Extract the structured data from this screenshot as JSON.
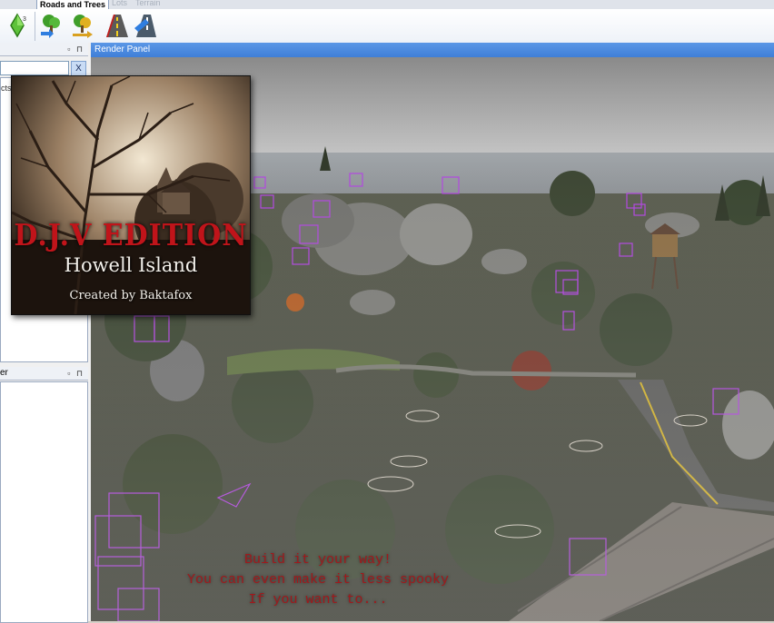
{
  "tabs": [
    {
      "label": "Roads and Trees",
      "active": true
    },
    {
      "label": "Lots",
      "active": false
    },
    {
      "label": "Terrain",
      "active": false
    }
  ],
  "toolbar": {
    "icons": [
      "sims-plumbob-icon",
      "tree-add-icon",
      "tree-swap-icon",
      "road-icon",
      "road-edit-icon"
    ]
  },
  "left_panel": {
    "search_clear": "X",
    "subtab_fragment": "cts",
    "lower_header_fragment": "er",
    "pin_glyphs": "▫ ⊓"
  },
  "render_panel": {
    "title": "Render Panel"
  },
  "poster": {
    "edition": "D.J.V EDITION",
    "title": "Howell Island",
    "credit": "Created by Baktafox"
  },
  "caption": {
    "line1": "Build it your way!",
    "line2": "You can even make it less spooky",
    "line3": "If you want to..."
  },
  "colors": {
    "header_blue": "#3f7fd8",
    "caption_red": "#a0191c",
    "edition_red": "#c0141a",
    "marker_purple": "#b040e0"
  }
}
